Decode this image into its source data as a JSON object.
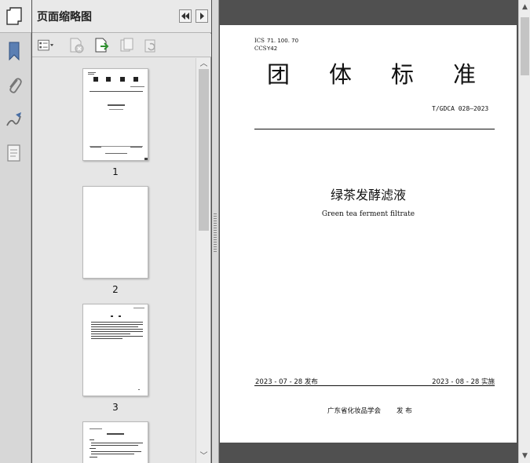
{
  "panel": {
    "title": "页面缩略图",
    "thumbnails": [
      {
        "page_number": "1"
      },
      {
        "page_number": "2"
      },
      {
        "page_number": "3"
      }
    ]
  },
  "rail": {
    "icons": [
      "pages-icon",
      "bookmark-icon",
      "attachment-icon",
      "signature-icon",
      "layers-icon"
    ]
  },
  "toolbar": {
    "icons": [
      "thumbnail-options-icon",
      "delete-page-icon",
      "insert-page-icon",
      "extract-page-icon",
      "rotate-page-icon"
    ]
  },
  "document": {
    "ics_label": "ICS",
    "ics_value": "71. 100. 70",
    "ccs_label": "CCS",
    "ccs_value": "Y42",
    "standard_type_chars": [
      "团",
      "体",
      "标",
      "准"
    ],
    "standard_number": "T/GDCA 028—2023",
    "title_cn": "绿茶发酵滤液",
    "title_en": "Green tea ferment filtrate",
    "publish_date": "2023 - 07 - 28 发布",
    "implement_date": "2023 - 08 - 28 实施",
    "issuer": "广东省化妆品学会",
    "issue_word": "发  布"
  },
  "colors": {
    "window_bg": "#505050",
    "panel_bg": "#e6e6e6",
    "page_bg": "#ffffff"
  }
}
